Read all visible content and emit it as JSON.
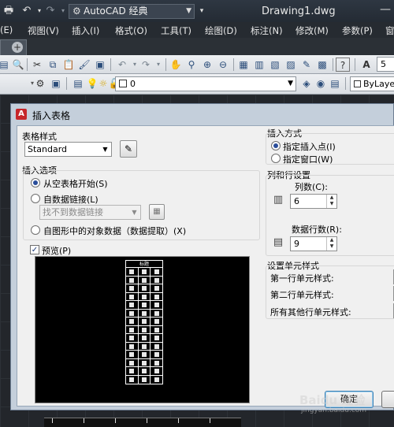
{
  "titlebar": {
    "workspace": "AutoCAD 经典",
    "document": "Drawing1.dwg",
    "icons": [
      "print-icon",
      "undo-icon",
      "redo-icon",
      "gear-icon"
    ]
  },
  "menubar": {
    "items": [
      "(E)",
      "视图(V)",
      "插入(I)",
      "格式(O)",
      "工具(T)",
      "绘图(D)",
      "标注(N)",
      "修改(M)",
      "参数(P)",
      "窗"
    ]
  },
  "toolbar2": {
    "layer_value": "0",
    "bylayer": "ByLayer",
    "right_value": "5"
  },
  "dialog": {
    "title": "插入表格",
    "table_style": {
      "label": "表格样式",
      "value": "Standard"
    },
    "insert_options": {
      "label": "插入选项",
      "opt_empty": "从空表格开始(S)",
      "opt_datalink": "自数据链接(L)",
      "datalink_value": "找不到数据链接",
      "opt_object_data": "自图形中的对象数据（数据提取）(X)"
    },
    "preview": {
      "label": "预览(P)",
      "table_title": "标题",
      "header_cells": [
        "表头",
        "表头",
        "表头"
      ]
    },
    "insert_method": {
      "label": "插入方式",
      "opt_point": "指定插入点(I)",
      "opt_window": "指定窗口(W)"
    },
    "col_row_settings": {
      "label": "列和行设置",
      "columns_label": "列数(C):",
      "columns_value": "6",
      "rows_label": "数据行数(R):",
      "rows_value": "9"
    },
    "cell_styles": {
      "label": "设置单元样式",
      "first_row": "第一行单元样式:",
      "second_row": "第二行单元样式:",
      "other_rows": "所有其他行单元样式:"
    },
    "ok_button": "确定"
  },
  "watermark": {
    "text": "Baidu 经验",
    "sub": "jingyan.baidu.com"
  }
}
